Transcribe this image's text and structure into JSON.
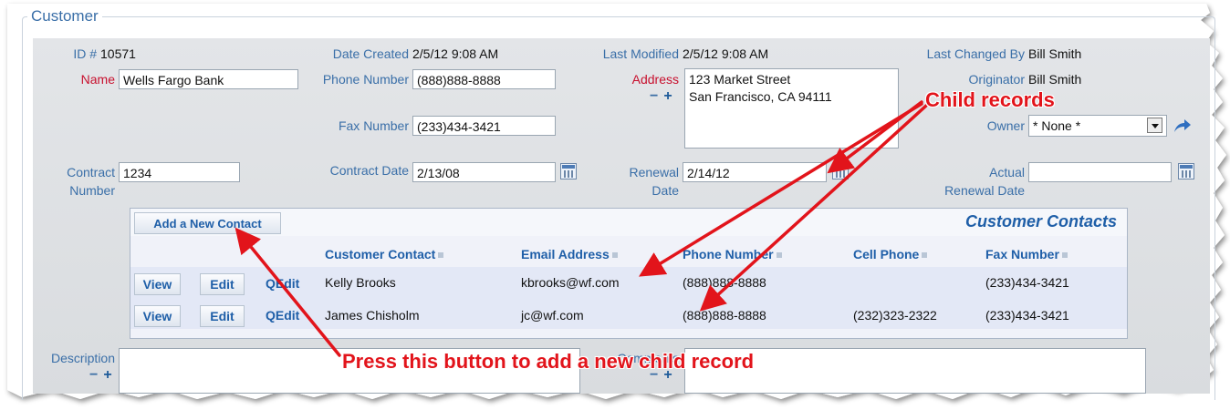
{
  "section": {
    "title": "Customer"
  },
  "header": {
    "id_label": "ID #",
    "id_value": "10571",
    "date_created_label": "Date Created",
    "date_created_value": "2/5/12 9:08 AM",
    "last_modified_label": "Last Modified",
    "last_modified_value": "2/5/12 9:08 AM",
    "last_changed_by_label": "Last Changed By",
    "last_changed_by_value": "Bill Smith",
    "originator_label": "Originator",
    "originator_value": "Bill Smith"
  },
  "fields": {
    "name_label": "Name",
    "name_value": "Wells Fargo Bank",
    "phone_label": "Phone Number",
    "phone_value": "(888)888-8888",
    "fax_label": "Fax Number",
    "fax_value": "(233)434-3421",
    "address_label": "Address",
    "address_line1": "123 Market Street",
    "address_line2": "San Francisco, CA 94111",
    "owner_label": "Owner",
    "owner_value": "* None *",
    "contract_number_label_1": "Contract",
    "contract_number_label_2": "Number",
    "contract_number_value": "1234",
    "contract_date_label": "Contract Date",
    "contract_date_value": "2/13/08",
    "renewal_label_1": "Renewal",
    "renewal_label_2": "Date",
    "renewal_value": "2/14/12",
    "actual_renewal_label_1": "Actual",
    "actual_renewal_label_2": "Renewal Date",
    "actual_renewal_value": "",
    "description_label": "Description",
    "comments_label": "Comments"
  },
  "contacts": {
    "add_button": "Add a New Contact",
    "title": "Customer Contacts",
    "columns": [
      "Customer Contact",
      "Email Address",
      "Phone Number",
      "Cell Phone",
      "Fax Number"
    ],
    "row_buttons": {
      "view": "View",
      "edit": "Edit",
      "qedit": "QEdit"
    },
    "rows": [
      {
        "name": "Kelly Brooks",
        "email": "kbrooks@wf.com",
        "phone": "(888)888-8888",
        "cell": "",
        "fax": "(233)434-3421"
      },
      {
        "name": "James Chisholm",
        "email": "jc@wf.com",
        "phone": "(888)888-8888",
        "cell": "(232)323-2322",
        "fax": "(233)434-3421"
      }
    ]
  },
  "annotations": {
    "child_records": "Child records",
    "press_button": "Press this button to add a new child record"
  },
  "colors": {
    "label_blue": "#3a6fa8",
    "required_red": "#c8102e",
    "annotation_red": "#e2141b",
    "header_blue": "#1f5fa8"
  }
}
